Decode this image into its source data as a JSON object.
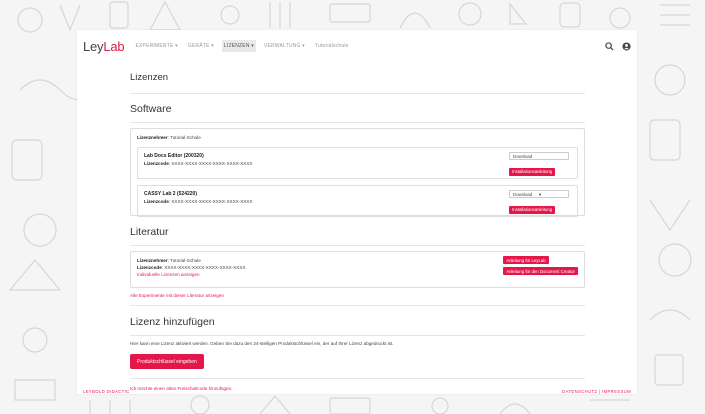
{
  "brand": {
    "ley": "Ley",
    "lab": "Lab",
    "accent": "#e5174a"
  },
  "nav": {
    "items": [
      "EXPERIMENTE ▾",
      "GERÄTE ▾",
      "LIZENZEN ▾",
      "VERWALTUNG ▾",
      "Tutorialschule"
    ],
    "active_index": 2,
    "icons": [
      "search-icon",
      "user-icon"
    ]
  },
  "page": {
    "title": "Lizenzen"
  },
  "software": {
    "heading": "Software",
    "licensee_label": "Lizenznehmer",
    "licensee_value": ": Tutorial-Schule",
    "products": [
      {
        "title": "Lab Docs Editor (200320)",
        "code_label": "Lizenzcode",
        "code_value": ": XXXX-XXXX-XXXX-XXXX-XXXX-XXXX",
        "download_label": "Download",
        "install_label": "Installationsanleitung"
      },
      {
        "title": "CASSY Lab 2 (524220)",
        "code_label": "Lizenzcode",
        "code_value": ": XXXX-XXXX-XXXX-XXXX-XXXX-XXXX",
        "download_label": "Download",
        "install_label": "Installationsanleitung"
      }
    ]
  },
  "literature": {
    "heading": "Literatur",
    "licensee_label": "Lizenznehmer",
    "licensee_value": ": Tutorial-Schule",
    "code_label": "Lizenzcode",
    "code_value": ": XXXX-XXXX-XXXX-XXXX-XXXX-XXXX",
    "individual_link": "Individuelle Lizenzen anzeigen",
    "btn_leylab": "Anleitung für LeyLab",
    "btn_creator": "Anleitung für den Document Creator",
    "all_experiments_link": "Alle Experimente mit dieser Literatur anzeigen"
  },
  "add_license": {
    "heading": "Lizenz hinzufügen",
    "description": "Hier kann eine Lizenz aktiviert werden. Geben Sie dazu den 24-stelligen Produktschlüssel ein, der auf Ihrer Lizenz abgedruckt ist.",
    "button": "Produktschlüssel eingeben",
    "old_code_link": "Ich möchte einen alten Freischaltcode hinzufügen."
  },
  "footer": {
    "left": "LEYBOLD DIDACTIC",
    "right": "DATENSCHUTZ | IMPRESSUM"
  }
}
